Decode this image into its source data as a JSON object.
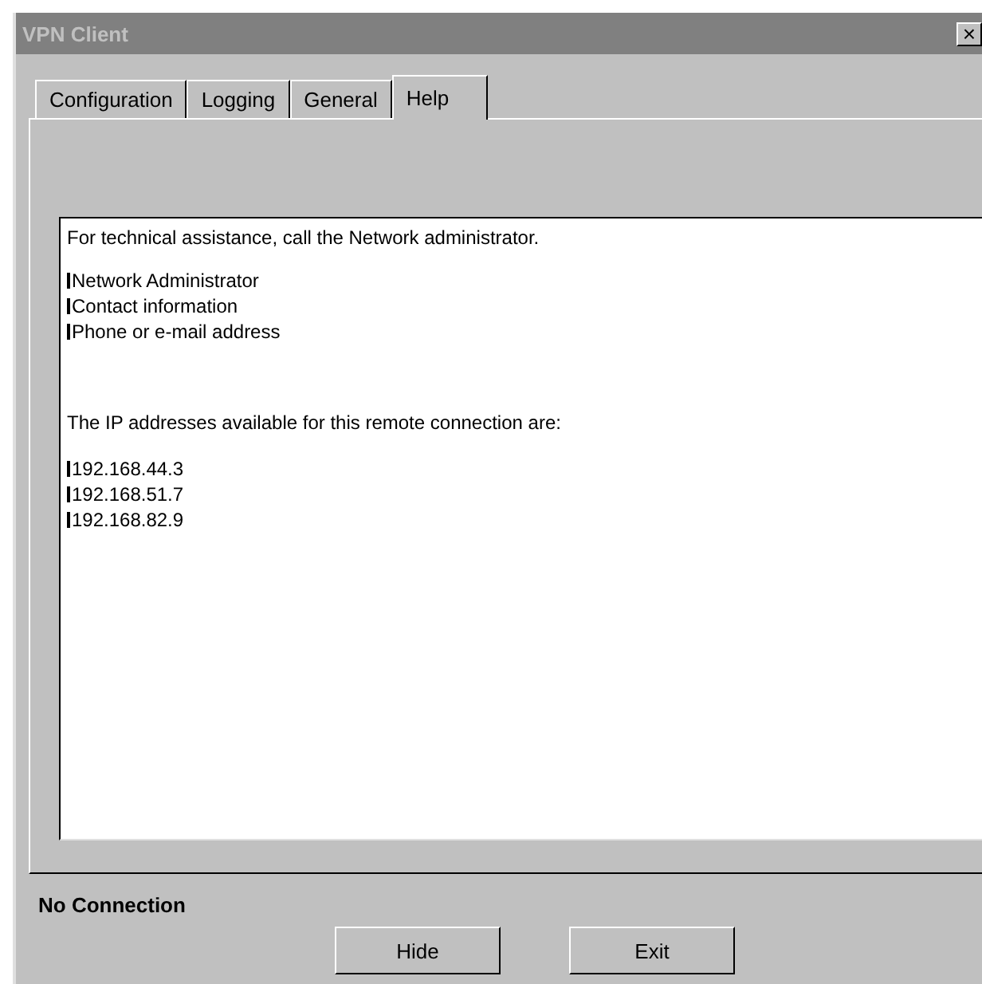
{
  "window": {
    "title": "VPN Client",
    "close": "×"
  },
  "tabs": [
    {
      "label": "Configuration",
      "selected": false
    },
    {
      "label": "Logging",
      "selected": false
    },
    {
      "label": "General",
      "selected": false
    },
    {
      "label": "Help",
      "selected": true
    }
  ],
  "help": {
    "intro": "For technical assistance, call the Network administrator.",
    "contacts": [
      "Network Administrator",
      "Contact information",
      "Phone or e-mail address"
    ],
    "ip_intro": "The IP addresses available for this remote connection are:",
    "ip_addresses": [
      "192.168.44.3",
      "192.168.51.7",
      "192.168.82.9"
    ]
  },
  "status": "No Connection",
  "buttons": [
    "Hide",
    "Exit"
  ]
}
